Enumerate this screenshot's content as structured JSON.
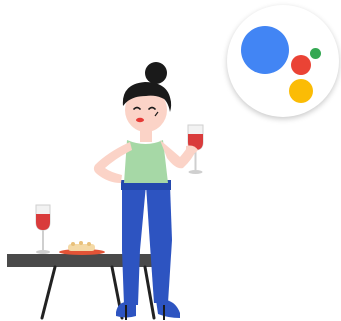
{
  "colors": {
    "assistant_blue": "#4285F4",
    "assistant_red": "#EA4335",
    "assistant_yellow": "#FBBC05",
    "assistant_green": "#34A853",
    "wine": "#d93b3b",
    "hair": "#1a1a1a",
    "skin": "#fbd3c7",
    "top": "#a6d8a6",
    "pants": "#2d54c1",
    "table": "#4a4a4a",
    "lips": "#e53935"
  },
  "icons": {
    "assistant_logo": "google-assistant-logo",
    "glass_on_table": "wine-glass-icon",
    "glass_in_hand": "wine-glass-icon",
    "snack_plate": "snack-plate-icon"
  }
}
